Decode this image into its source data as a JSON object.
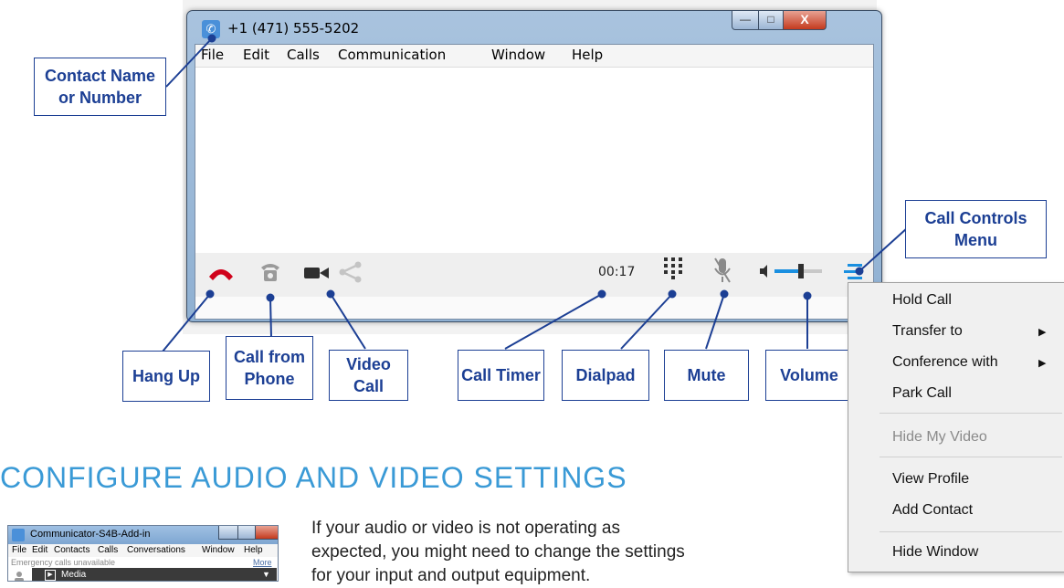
{
  "window": {
    "title": "+1 (471) 555-5202",
    "controls": {
      "minimize": "—",
      "maximize": "□",
      "close": "X"
    }
  },
  "menubar": [
    "File",
    "Edit",
    "Calls",
    "Communication",
    "Window",
    "Help"
  ],
  "toolbar": {
    "timer": "00:17",
    "icons": [
      "hang-up-icon",
      "phone-icon",
      "video-camera-icon",
      "share-icon",
      "dialpad-icon",
      "mute-icon",
      "volume-icon",
      "menu-icon"
    ],
    "volume_level": 0.55
  },
  "callouts": {
    "contact": "Contact Name or Number",
    "hangup": "Hang Up",
    "call_from_phone": "Call from Phone",
    "video_call": "Video Call",
    "call_timer": "Call Timer",
    "dialpad": "Dialpad",
    "mute": "Mute",
    "volume": "Volume",
    "call_controls": "Call Controls Menu"
  },
  "context_menu": {
    "items": [
      {
        "label": "Hold Call"
      },
      {
        "label": "Transfer to"
      },
      {
        "label": "Conference with"
      },
      {
        "label": "Park Call"
      },
      {
        "label": "Hide My Video"
      },
      {
        "label": "View Profile"
      },
      {
        "label": "Add Contact"
      },
      {
        "label": "Hide Window"
      }
    ]
  },
  "section": {
    "heading": "CONFIGURE AUDIO AND VIDEO SETTINGS",
    "paragraph": "If your audio or video is not operating as expected, you might need to change the settings for your input and output equipment."
  },
  "thumbnail": {
    "title": "Communicator-S4B-Add-in",
    "menu": [
      "File",
      "Edit",
      "Contacts",
      "Calls",
      "Conversations",
      "Window",
      "Help"
    ],
    "emergency": "Emergency calls unavailable",
    "more": "More",
    "media": "Media"
  },
  "colors": {
    "callout_blue": "#1c3f94",
    "heading_blue": "#3a9ad6",
    "hangup_red": "#d0021b",
    "accent_blue": "#1a8fe0"
  }
}
